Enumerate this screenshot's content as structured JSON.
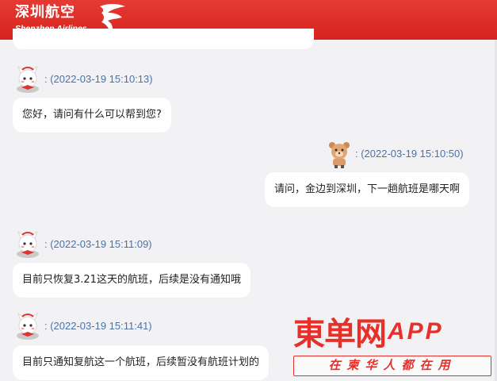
{
  "header": {
    "logo_cn": "深圳航空",
    "logo_en": "Shenzhen Airlines",
    "brand_color": "#d8231d"
  },
  "messages": [
    {
      "sender": "agent",
      "time": ": (2022-03-19 15:10:13)",
      "text": "您好，请问有什么可以帮到您?"
    },
    {
      "sender": "user",
      "time": ": (2022-03-19 15:10:50)",
      "text": "请问，金边到深圳，下一趟航班是哪天啊"
    },
    {
      "sender": "agent",
      "time": ": (2022-03-19 15:11:09)",
      "text": "目前只恢复3.21这天的航班，后续是没有通知哦"
    },
    {
      "sender": "agent",
      "time": ": (2022-03-19 15:11:41)",
      "text": "目前只通知复航这一个航班，后续暂没有航班计划的"
    }
  ],
  "watermark": {
    "main": "東单网",
    "app": "APP",
    "sub": "在柬华人都在用",
    "color": "#e8302a"
  }
}
